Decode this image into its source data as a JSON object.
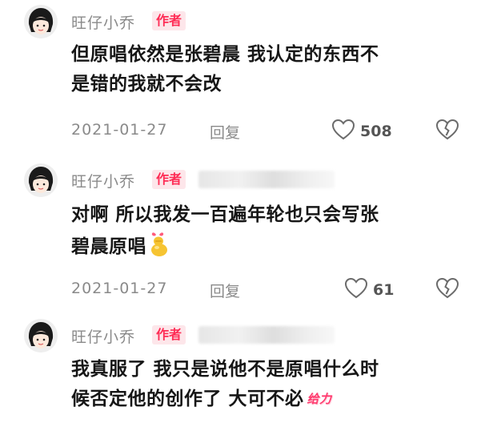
{
  "comments": [
    {
      "username": "旺仔小乔",
      "badge": "作者",
      "text_line1": "但原唱依然是张碧晨 我认定的东西不",
      "text_line2": "是错的我就不会改",
      "date": "2021-01-27",
      "reply": "回复",
      "likes": "508"
    },
    {
      "username": "旺仔小乔",
      "badge": "作者",
      "text_line1": "对啊 所以我发一百遍年轮也只会写张",
      "text_line2": "碧晨原唱",
      "date": "2021-01-27",
      "reply": "回复",
      "likes": "61"
    },
    {
      "username": "旺仔小乔",
      "badge": "作者",
      "text_line1": "我真服了 我只是说他不是原唱什么时",
      "text_line2": "候否定他的创作了 大可不必",
      "sticker": "给力"
    }
  ],
  "colors": {
    "badge_text": "#fe2c55",
    "badge_bg": "#fde6ea",
    "meta_text": "#8a8a8a"
  }
}
